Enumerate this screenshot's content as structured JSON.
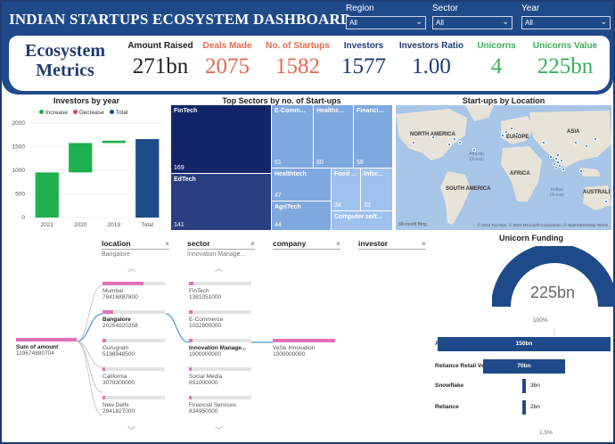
{
  "header": {
    "title": "INDIAN STARTUPS ECOSYSTEM DASHBOARD",
    "filters": [
      {
        "label": "Region",
        "value": "All"
      },
      {
        "label": "Sector",
        "value": "All"
      },
      {
        "label": "Year",
        "value": "All"
      }
    ]
  },
  "metrics": {
    "title_line1": "Ecosystem",
    "title_line2": "Metrics",
    "kpis": [
      {
        "label": "Amount Raised",
        "value": "271bn",
        "color": "#222222"
      },
      {
        "label": "Deals Made",
        "value": "2075",
        "color": "#e46b4f"
      },
      {
        "label": "No. of Startups",
        "value": "1582",
        "color": "#e46b4f"
      },
      {
        "label": "Investors",
        "value": "1577",
        "color": "#1f3b73"
      },
      {
        "label": "Investors Ratio",
        "value": "1.00",
        "color": "#1f3b73"
      },
      {
        "label": "Unicorns",
        "value": "4",
        "color": "#3cae5a"
      },
      {
        "label": "Unicorns Value",
        "value": "225bn",
        "color": "#3cae5a"
      }
    ]
  },
  "investors_by_year": {
    "title": "Investors by year",
    "legend": [
      {
        "label": "Increase",
        "color": "#1fb050"
      },
      {
        "label": "Decrease",
        "color": "#e0424c"
      },
      {
        "label": "Total",
        "color": "#1f4a8a"
      }
    ]
  },
  "chart_data": {
    "type": "bar",
    "title": "Investors by year",
    "subtype": "waterfall",
    "categories": [
      "2021",
      "2020",
      "2019",
      "Total"
    ],
    "series": [
      {
        "name": "Increase",
        "values": [
          955,
          622,
          50,
          null
        ]
      },
      {
        "name": "Total",
        "values": [
          null,
          null,
          null,
          1577
        ]
      }
    ],
    "bar_ranges": [
      [
        0,
        955
      ],
      [
        955,
        1577
      ],
      [
        1577,
        1627
      ],
      [
        0,
        1660
      ]
    ],
    "yticks": [
      0,
      500,
      1000,
      1500,
      2000
    ],
    "ylim": [
      0,
      2000
    ],
    "grid": true,
    "legend_position": "top"
  },
  "treemap": {
    "title": "Top Sectors by no. of Start-ups",
    "tiles": [
      {
        "label": "FinTech",
        "count": "169",
        "color": "#13256a"
      },
      {
        "label": "EdTech",
        "count": "141",
        "color": "#2a3f82"
      },
      {
        "label": "E-Comm...",
        "count": "61",
        "color": "#7fa8de"
      },
      {
        "label": "Healthc...",
        "count": "60",
        "color": "#7fa8de"
      },
      {
        "label": "Financi...",
        "count": "58",
        "color": "#7fa8de"
      },
      {
        "label": "Healthtech",
        "count": "47",
        "color": "#7fa8de"
      },
      {
        "label": "AgriTech",
        "count": "44",
        "color": "#7fa8de"
      },
      {
        "label": "Food ...",
        "count": "34",
        "color": "#9fc1ee"
      },
      {
        "label": "Infor...",
        "count": "33",
        "color": "#9fc1ee"
      },
      {
        "label": "Computer soft...",
        "count": "",
        "color": "#9fc1ee"
      }
    ]
  },
  "map": {
    "title": "Start-ups by Location",
    "labels": [
      "NORTH AMERICA",
      "EUROPE",
      "ASIA",
      "AFRICA",
      "SOUTH AMERICA",
      "AUSTRALI"
    ],
    "oceans": [
      "Atlantic Ocean",
      "Indian Ocean"
    ],
    "attribution": "© 2024 TomTom, © 2024 Microsoft Corporation, © OpenStreetMap  Terms",
    "brand": "Microsoft Bing"
  },
  "decomp": {
    "root_label": "Sum of amount",
    "root_value": "119674880704",
    "columns": [
      {
        "header": "location",
        "sub": "Bangalore"
      },
      {
        "header": "sector",
        "sub": "Innovation Manage..."
      },
      {
        "header": "company",
        "sub": ""
      },
      {
        "header": "investor",
        "sub": ""
      }
    ],
    "locations": [
      {
        "name": "Mumbai",
        "value": "78416887800",
        "fill": 0.66
      },
      {
        "name": "Bangalore",
        "value": "20254920358",
        "fill": 0.17
      },
      {
        "name": "Gurugram",
        "value": "5198948500",
        "fill": 0.05
      },
      {
        "name": "California",
        "value": "3078300000",
        "fill": 0.03
      },
      {
        "name": "New Delhi",
        "value": "2941827000",
        "fill": 0.03
      }
    ],
    "sectors": [
      {
        "name": "FinTech",
        "value": "1381051000",
        "fill": 0.07
      },
      {
        "name": "E-Commerce",
        "value": "1032800000",
        "fill": 0.05
      },
      {
        "name": "Innovation Manage...",
        "value": "1000000000",
        "fill": 0.05
      },
      {
        "name": "Social Media",
        "value": "851000000",
        "fill": 0.04
      },
      {
        "name": "Financial Services",
        "value": "834950000",
        "fill": 0.04
      }
    ],
    "company": {
      "name": "VeSe Innovation",
      "value": "1000000000"
    }
  },
  "unicorn_funding": {
    "title": "Unicorn Funding",
    "gauge_value": "225bn",
    "gauge_percent": "100%",
    "funnel_bottom_percent": "1.5%",
    "funnel": [
      {
        "name": "Alteria Capital",
        "value": "150bn",
        "share": 1.0
      },
      {
        "name": "Reliance Retail Ve...",
        "value": "70bn",
        "share": 0.47
      },
      {
        "name": "Snowflake",
        "value": "3bn",
        "share": 0.02
      },
      {
        "name": "Reliance",
        "value": "2bn",
        "share": 0.015
      }
    ]
  }
}
